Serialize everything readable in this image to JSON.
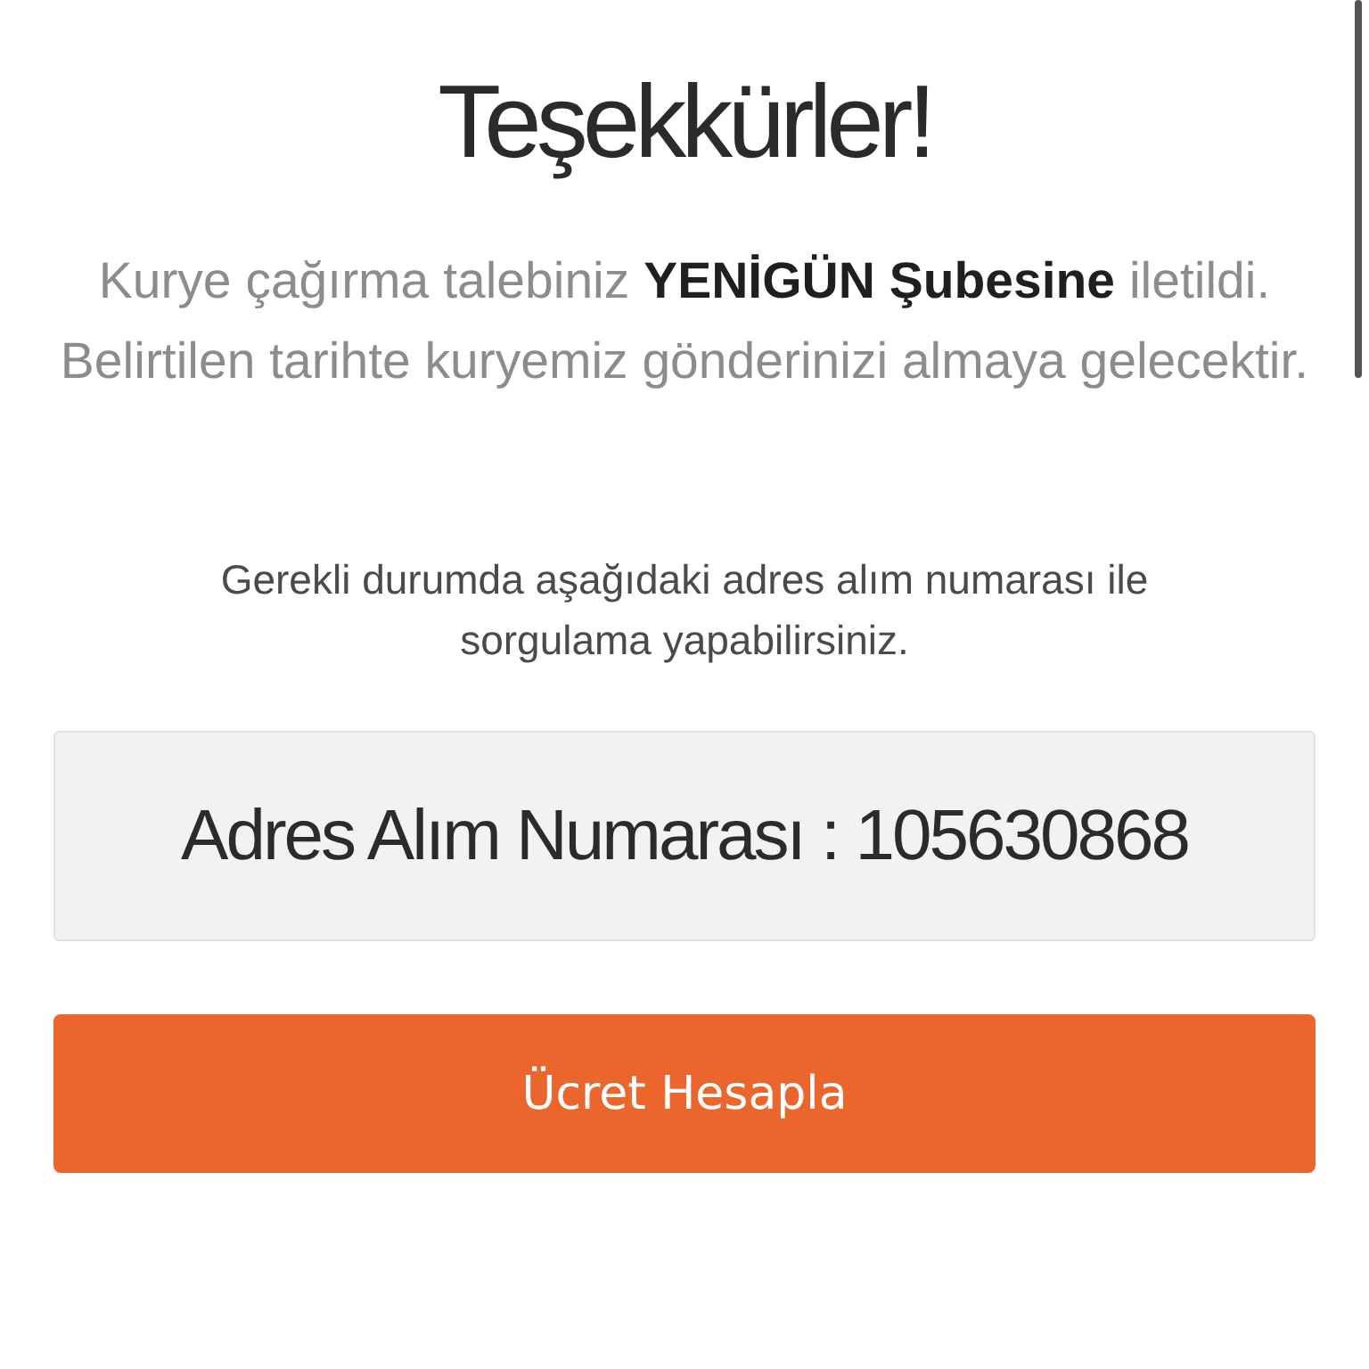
{
  "title": "Teşekkürler!",
  "message": "Kurye çağırma talebiniz **YENİGÜN Şubesine** iletildi. Belirtilen tarihte kuryemiz gönderinizi almaya gelecektir.",
  "hint": "Gerekli durumda aşağıdaki adres alım numarası ile sorgulama yapabilirsiniz.",
  "reference": {
    "label": "Adres Alım Numarası :",
    "value": "105630868"
  },
  "buttons": [
    "Ücret Hesapla"
  ]
}
